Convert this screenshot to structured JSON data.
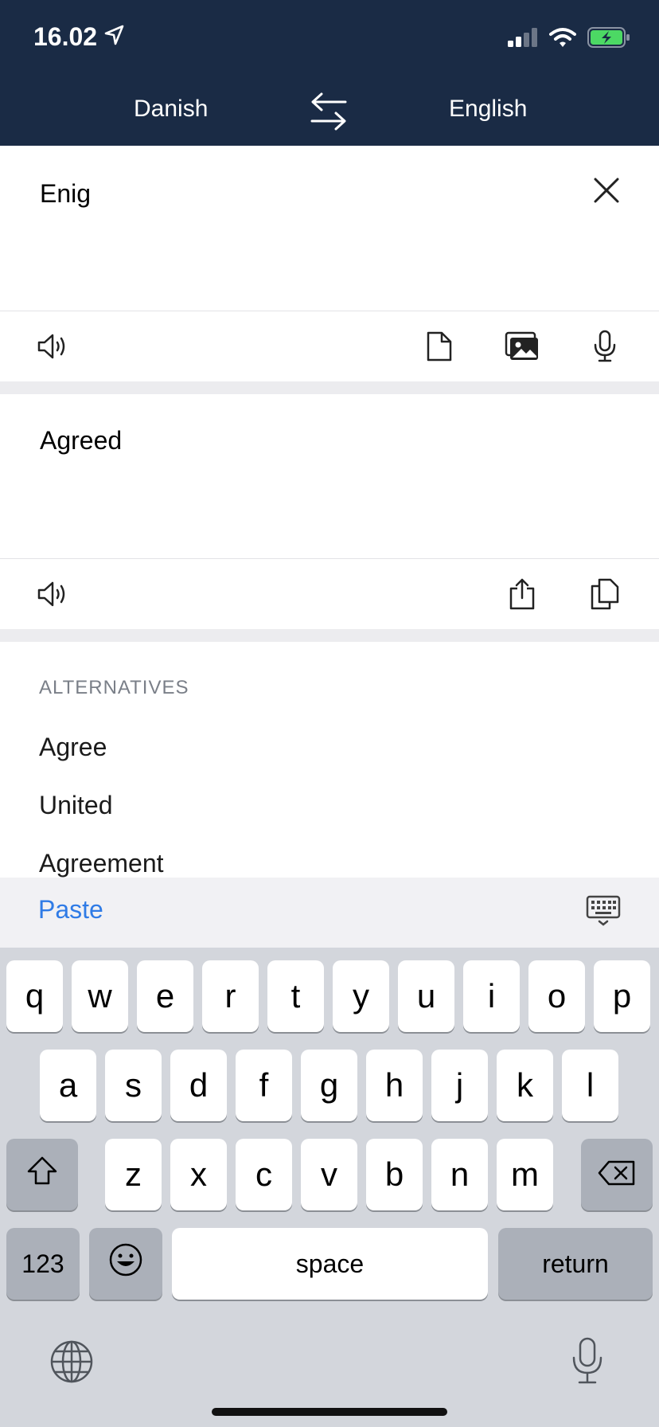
{
  "status_bar": {
    "time": "16.02",
    "icons": [
      "location-arrow-icon",
      "signal-icon",
      "wifi-icon",
      "battery-charging-icon"
    ]
  },
  "languages": {
    "source": "Danish",
    "target": "English",
    "swap_icon": "swap-arrows-icon"
  },
  "input": {
    "text": "Enig",
    "clear_icon": "close-icon",
    "toolbar_icons": [
      "speaker-icon",
      "document-icon",
      "image-icon",
      "microphone-icon"
    ]
  },
  "output": {
    "text": "Agreed",
    "toolbar_icons": [
      "speaker-icon",
      "share-icon",
      "copy-icon"
    ]
  },
  "alternatives": {
    "title": "ALTERNATIVES",
    "items": [
      "Agree",
      "United",
      "Agreement"
    ]
  },
  "paste_bar": {
    "paste_label": "Paste",
    "keyboard_icon": "keyboard-dismiss-icon"
  },
  "keyboard": {
    "row1": [
      "q",
      "w",
      "e",
      "r",
      "t",
      "y",
      "u",
      "i",
      "o",
      "p"
    ],
    "row2": [
      "a",
      "s",
      "d",
      "f",
      "g",
      "h",
      "j",
      "k",
      "l"
    ],
    "row3": [
      "z",
      "x",
      "c",
      "v",
      "b",
      "n",
      "m"
    ],
    "numbers_label": "123",
    "space_label": "space",
    "return_label": "return"
  },
  "colors": {
    "header_bg": "#1a2b45",
    "accent_blue": "#2f7be6",
    "battery_green": "#4cd964"
  }
}
